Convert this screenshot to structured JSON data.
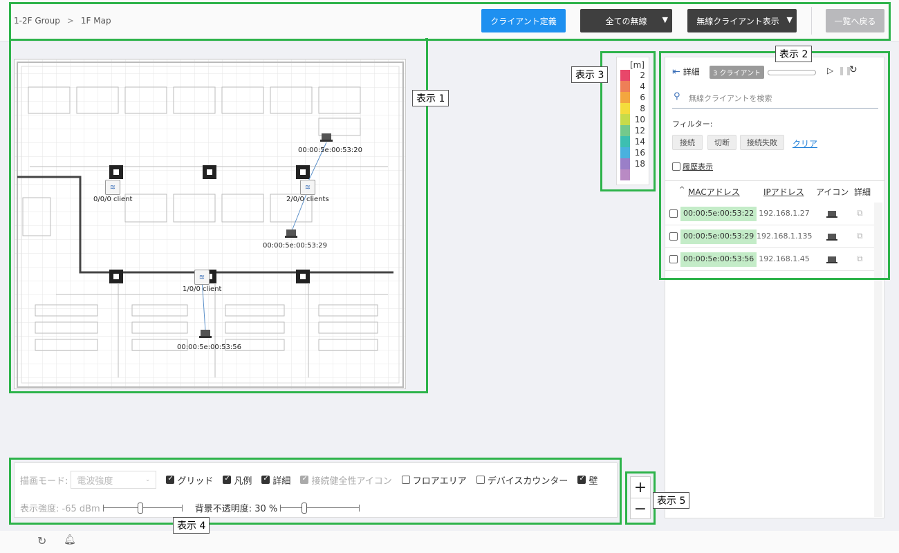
{
  "breadcrumb": {
    "group": "1-2F Group",
    "separator": ">",
    "map": "1F Map"
  },
  "header": {
    "client_def_label": "クライアント定義",
    "wireless_filter_label": "全ての無線",
    "client_display_label": "無線クライアント表示",
    "back_label": "一覧へ戻る",
    "dropdown_arrow": "▼"
  },
  "callouts": {
    "c1": "表示 1",
    "c2": "表示 2",
    "c3": "表示 3",
    "c4": "表示 4",
    "c5": "表示 5"
  },
  "map": {
    "aps": [
      {
        "label": "0/0/0 client"
      },
      {
        "label": "2/0/0 clients"
      },
      {
        "label": "1/0/0 client"
      }
    ],
    "clients": [
      {
        "label": "00:00:5e:00:53:20"
      },
      {
        "label": "00:00:5e:00:53:29"
      },
      {
        "label": "00:00:5e:00:53:56"
      }
    ]
  },
  "legend": {
    "unit": "[m]",
    "items": [
      {
        "value": "2",
        "color": "#e8476a"
      },
      {
        "value": "4",
        "color": "#ee7f57"
      },
      {
        "value": "6",
        "color": "#f3a63f"
      },
      {
        "value": "8",
        "color": "#f4dc3c"
      },
      {
        "value": "10",
        "color": "#c7db4a"
      },
      {
        "value": "12",
        "color": "#74c98c"
      },
      {
        "value": "14",
        "color": "#3dbfb1"
      },
      {
        "value": "16",
        "color": "#4ab1de"
      },
      {
        "value": "18",
        "color": "#9a7fc8"
      }
    ],
    "bottom_color": "#b98ac4"
  },
  "panel": {
    "detail_label": "詳細",
    "badge": "3 クライアント",
    "search_placeholder": "無線クライアントを検索",
    "filter_label": "フィルター:",
    "chips": [
      "接続",
      "切断",
      "接続失敗"
    ],
    "clear_label": "クリア",
    "history_label": "履歴表示",
    "sort_indicator": "^",
    "columns": {
      "mac": "MACアドレス",
      "ip": "IPアドレス",
      "icon": "アイコン",
      "detail": "詳細"
    },
    "rows": [
      {
        "mac": "00:00:5e:00:53:22",
        "ip": "192.168.1.27"
      },
      {
        "mac": "00:00:5e:00:53:29",
        "ip": "192.168.1.135"
      },
      {
        "mac": "00:00:5e:00:53:56",
        "ip": "192.168.1.45"
      }
    ]
  },
  "controls": {
    "draw_mode_label": "描画モード:",
    "draw_mode_value": "電波強度",
    "checkboxes": [
      {
        "label": "グリッド",
        "checked": true,
        "disabled": false
      },
      {
        "label": "凡例",
        "checked": true,
        "disabled": false
      },
      {
        "label": "詳細",
        "checked": true,
        "disabled": false
      },
      {
        "label": "接続健全性アイコン",
        "checked": true,
        "disabled": true
      },
      {
        "label": "フロアエリア",
        "checked": false,
        "disabled": false
      },
      {
        "label": "デバイスカウンター",
        "checked": false,
        "disabled": false
      },
      {
        "label": "壁",
        "checked": true,
        "disabled": false
      }
    ],
    "strength_label": "表示強度: -65 dBm",
    "opacity_label": "背景不透明度: 30 %",
    "strength_level": 0.47,
    "opacity_level": 0.3
  },
  "zoom": {
    "in": "+",
    "out": "−"
  },
  "colors": {
    "accent": "#1e90f0",
    "highlight": "#2db34a",
    "mac_bg": "#c4ecc8"
  }
}
